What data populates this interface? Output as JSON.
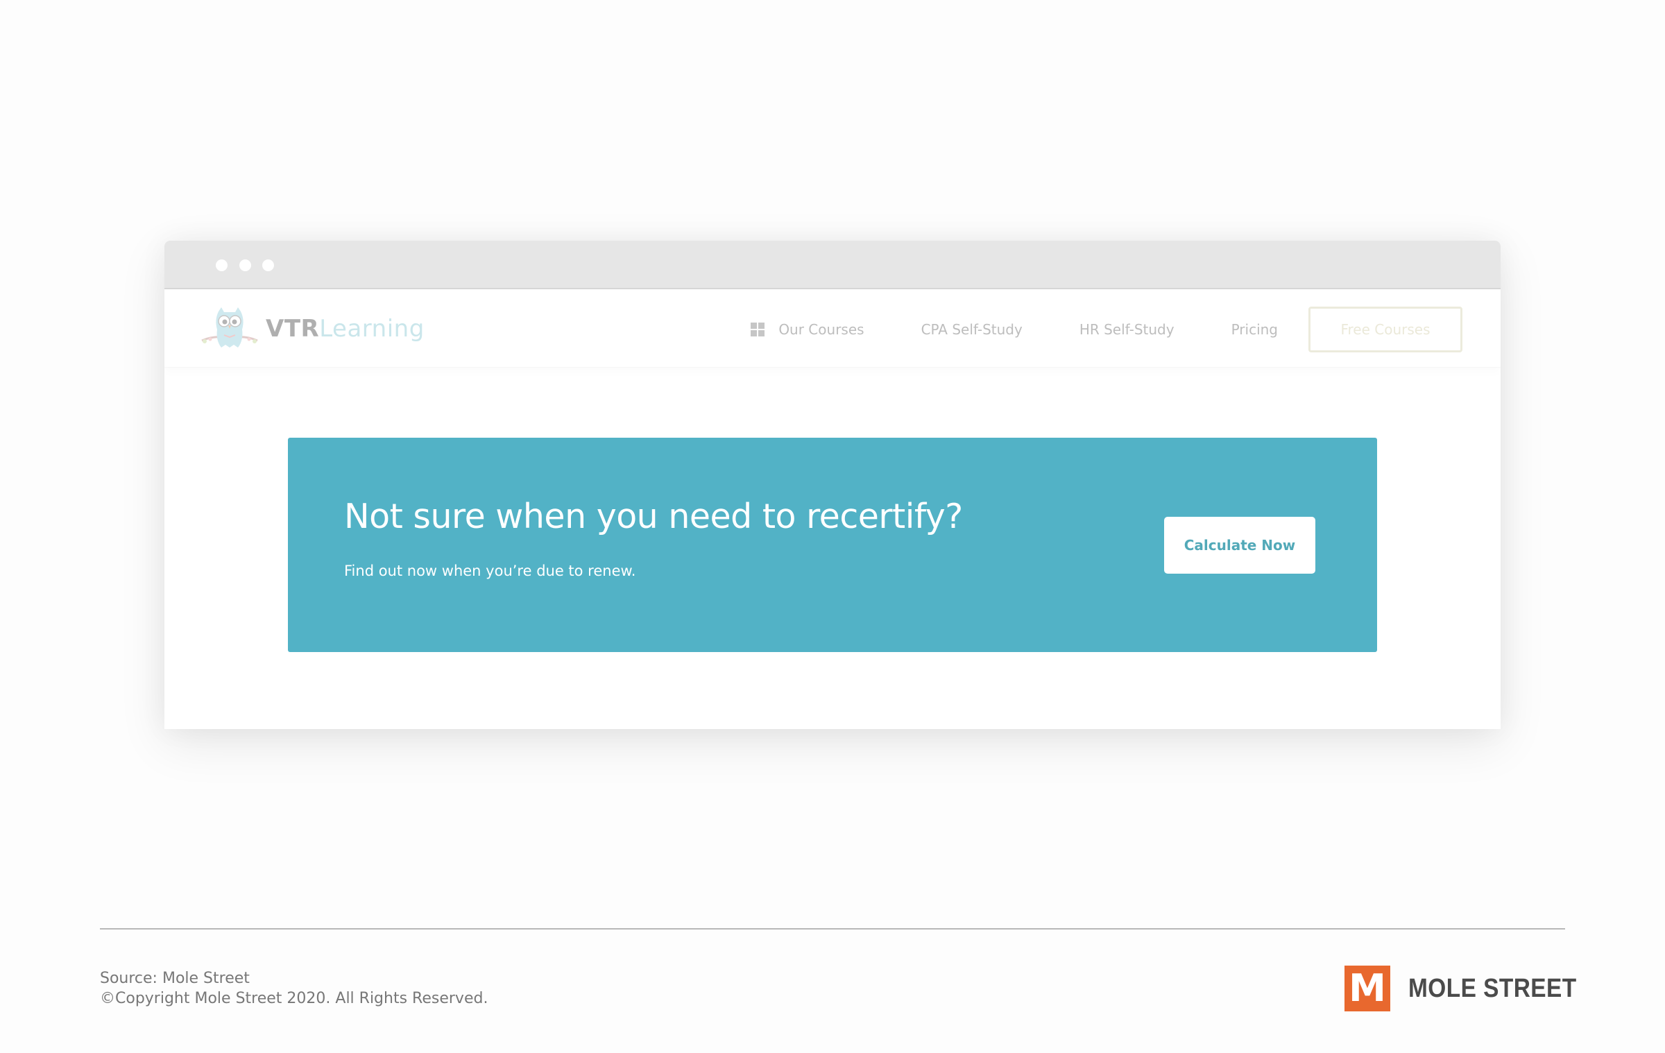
{
  "browser": {
    "window_controls": [
      "close",
      "minimize",
      "maximize"
    ]
  },
  "site": {
    "logo": {
      "part1": "VTR",
      "part2": "Learning",
      "icon": "owl-icon"
    },
    "nav": {
      "items": [
        {
          "label": "Our Courses",
          "icon": "grid-icon"
        },
        {
          "label": "CPA Self-Study"
        },
        {
          "label": "HR Self-Study"
        },
        {
          "label": "Pricing"
        }
      ],
      "cta_label": "Free Courses"
    },
    "banner": {
      "title": "Not sure when you need to recertify?",
      "subtitle": "Find out now when you’re due to renew.",
      "button_label": "Calculate Now",
      "background_color": "#52b2c6"
    }
  },
  "footer": {
    "source": "Source: Mole Street",
    "copyright": "©Copyright Mole Street 2020. All Rights Reserved.",
    "brand_mark": "M",
    "brand_name": "MOLE STREET",
    "brand_color": "#e8682e"
  }
}
